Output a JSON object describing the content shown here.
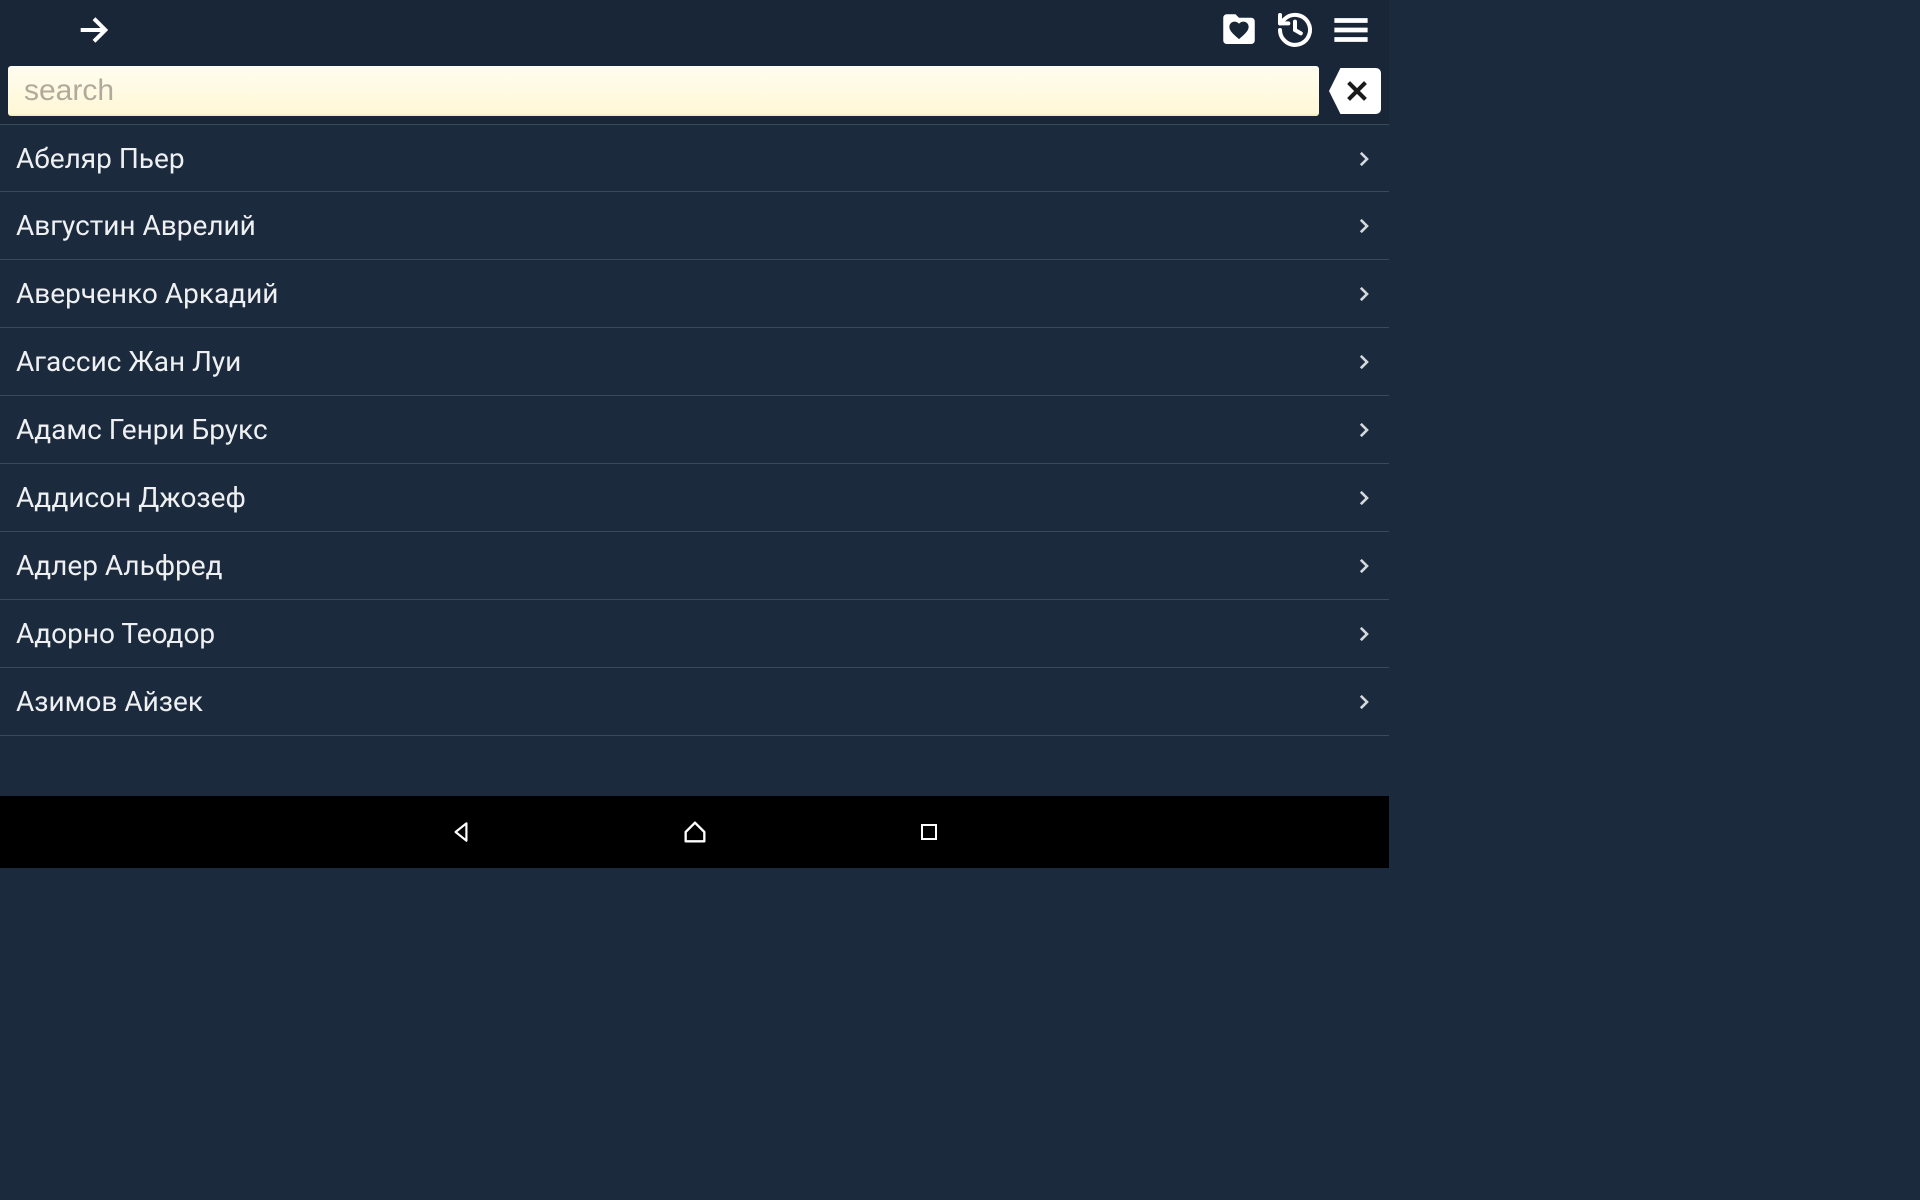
{
  "search": {
    "placeholder": "search",
    "value": ""
  },
  "list": {
    "items": [
      {
        "name": "Абеляр Пьер"
      },
      {
        "name": "Августин Аврелий"
      },
      {
        "name": "Аверченко Аркадий"
      },
      {
        "name": "Агассис Жан Луи"
      },
      {
        "name": "Адамс Генри Брукс"
      },
      {
        "name": "Аддисон Джозеф"
      },
      {
        "name": "Адлер Альфред"
      },
      {
        "name": "Адорно Теодор"
      },
      {
        "name": "Азимов Айзек"
      }
    ]
  }
}
